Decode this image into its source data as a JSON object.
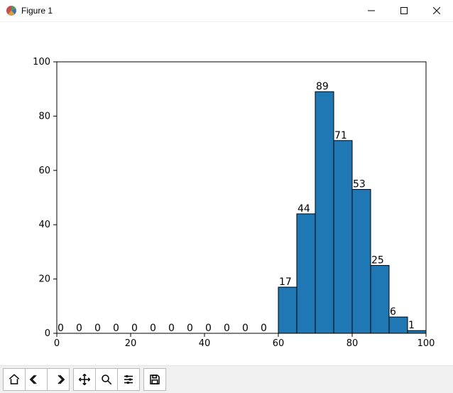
{
  "window": {
    "title": "Figure 1"
  },
  "toolbar": {
    "home": "home-icon",
    "back": "back-icon",
    "forward": "forward-icon",
    "pan": "pan-icon",
    "zoom": "zoom-icon",
    "configure": "configure-icon",
    "save": "save-icon"
  },
  "chart_data": {
    "type": "bar",
    "categories": [
      2.5,
      7.5,
      12.5,
      17.5,
      22.5,
      27.5,
      32.5,
      37.5,
      42.5,
      47.5,
      52.5,
      57.5,
      62.5,
      67.5,
      72.5,
      77.5,
      82.5,
      87.5,
      92.5,
      97.5
    ],
    "values": [
      0,
      0,
      0,
      0,
      0,
      0,
      0,
      0,
      0,
      0,
      0,
      0,
      17,
      44,
      89,
      71,
      53,
      25,
      6,
      1
    ],
    "bar_labels": [
      "0",
      "0",
      "0",
      "0",
      "0",
      "0",
      "0",
      "0",
      "0",
      "0",
      "0",
      "0",
      "17",
      "44",
      "89",
      "71",
      "53",
      "25",
      "6",
      "1"
    ],
    "title": "",
    "xlabel": "",
    "ylabel": "",
    "xlim": [
      0,
      100
    ],
    "ylim": [
      0,
      100
    ],
    "xticks": [
      0,
      20,
      40,
      60,
      80,
      100
    ],
    "yticks": [
      0,
      20,
      40,
      60,
      80,
      100
    ],
    "colors": {
      "bar_fill": "#1f77b4",
      "bar_edge": "#000000"
    }
  }
}
